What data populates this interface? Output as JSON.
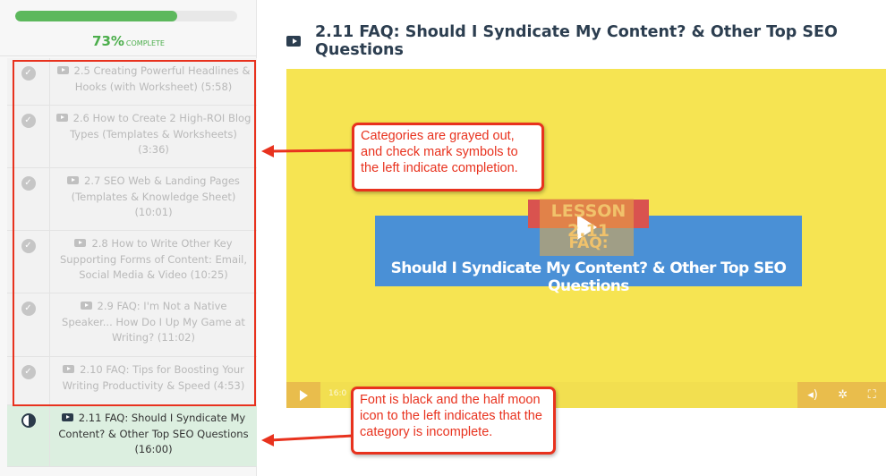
{
  "sidebar": {
    "progress_percent": 73,
    "progress_label": "73%",
    "complete_label": "COMPLETE",
    "items": [
      {
        "label": "2.5 Creating Powerful Headlines & Hooks (with Worksheet) (5:58)",
        "status": "complete"
      },
      {
        "label": "2.6 How to Create 2 High-ROI Blog Types (Templates & Worksheets) (3:36)",
        "status": "complete"
      },
      {
        "label": "2.7 SEO Web & Landing Pages (Templates & Knowledge Sheet) (10:01)",
        "status": "complete"
      },
      {
        "label": "2.8 How to Write Other Key Supporting Forms of Content: Email, Social Media & Video (10:25)",
        "status": "complete"
      },
      {
        "label": "2.9 FAQ: I'm Not a Native Speaker... How Do I Up My Game at Writing? (11:02)",
        "status": "complete"
      },
      {
        "label": "2.10 FAQ: Tips for Boosting Your Writing Productivity & Speed (4:53)",
        "status": "complete"
      },
      {
        "label": "2.11 FAQ: Should I Syndicate My Content? & Other Top SEO Questions (16:00)",
        "status": "incomplete"
      }
    ]
  },
  "main": {
    "title": "2.11 FAQ: Should I Syndicate My Content? & Other Top SEO Questions",
    "video": {
      "lesson_label": "LESSON 2.11",
      "faq_label": "FAQ:",
      "banner_text": "Should I Syndicate My Content? & Other Top SEO Questions",
      "time": "16:0",
      "colors": {
        "background": "#f6e452",
        "banner": "#4a90d6",
        "accent": "#e9bd4c"
      }
    }
  },
  "annotations": {
    "top": "Categories are grayed out, and check mark symbols to the left indicate completion.",
    "bottom": "Font is black and the half moon icon to the left indicates that the category is incomplete."
  }
}
